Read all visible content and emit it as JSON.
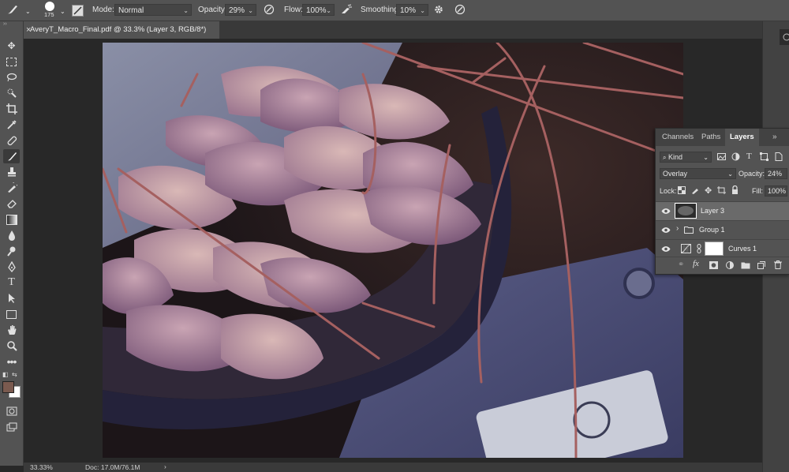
{
  "options": {
    "brush_size": "175",
    "mode_label": "Mode:",
    "mode_value": "Normal",
    "opacity_label": "Opacity:",
    "opacity_value": "29%",
    "flow_label": "Flow:",
    "flow_value": "100%",
    "smoothing_label": "Smoothing:",
    "smoothing_value": "10%"
  },
  "tab": {
    "title": "AveryT_Macro_Final.pdf @ 33.3% (Layer 3, RGB/8*)",
    "close": "×"
  },
  "status": {
    "zoom": "33.33%",
    "doc": "Doc: 17.0M/76.1M"
  },
  "layers_panel": {
    "tabs": [
      "Channels",
      "Paths",
      "Layers"
    ],
    "kind_value": "Kind",
    "blend_value": "Overlay",
    "opacity_label": "Opacity:",
    "opacity_value": "24%",
    "lock_label": "Lock:",
    "fill_label": "Fill:",
    "fill_value": "100%",
    "layers": [
      {
        "name": "Layer 3"
      },
      {
        "name": "Group 1"
      },
      {
        "name": "Curves 1"
      }
    ]
  },
  "colors": {
    "foreground": "#7a5a4f",
    "background": "#ffffff",
    "accent": "#5f5f5f"
  },
  "icons": [
    "brush-icon",
    "move-icon",
    "marquee-icon",
    "lasso-icon",
    "quick-select-icon",
    "crop-icon",
    "eyedropper-icon",
    "healing-icon",
    "brush-tool-icon",
    "stamp-icon",
    "history-brush-icon",
    "eraser-icon",
    "gradient-icon",
    "blur-icon",
    "dodge-icon",
    "pen-icon",
    "type-icon",
    "path-select-icon",
    "rectangle-icon",
    "hand-icon",
    "zoom-icon",
    "more-icon",
    "eye-icon",
    "folder-icon",
    "trash-icon"
  ]
}
